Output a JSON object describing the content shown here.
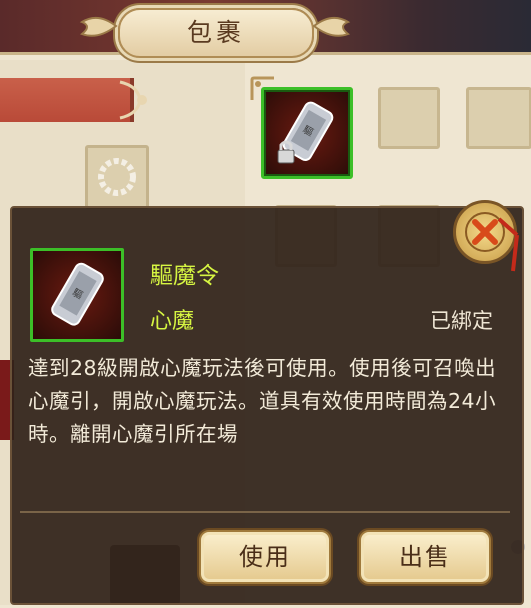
{
  "window": {
    "title": "包裹"
  },
  "tooltip": {
    "item_name": "驅魔令",
    "item_type": "心魔",
    "bound_status": "已綁定",
    "description": "達到28級開啟心魔玩法後可使用。使用後可召喚出心魔引，開啟心魔玩法。道具有效使用時間為24小時。離開心魔引所在場",
    "use_button": "使用",
    "sell_button": "出售"
  },
  "icons": {
    "item_icon": "demon-token-icon",
    "lock_icon": "lock-icon",
    "close_icon": "close-icon",
    "bracelet_icon": "bracelet-icon"
  },
  "colors": {
    "item_name": "#d6f542",
    "rarity_border": "#3cbf28",
    "tooltip_bg": "#30221a"
  }
}
